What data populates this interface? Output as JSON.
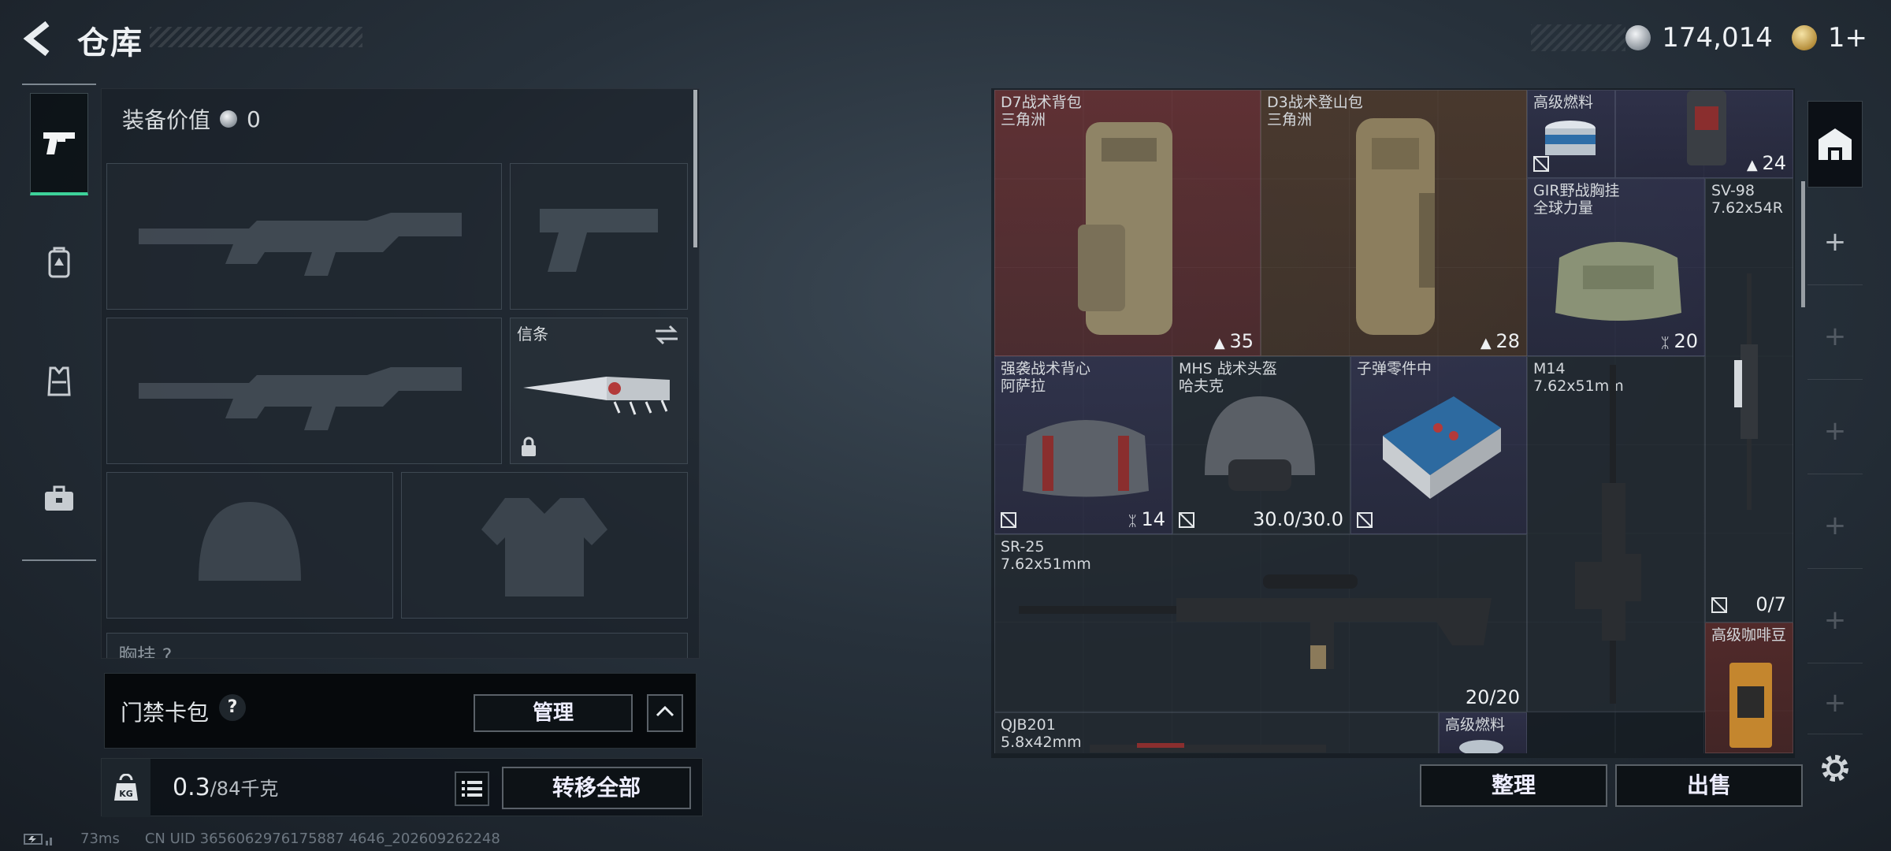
{
  "header": {
    "title": "仓库",
    "currency": {
      "silver": "174,014",
      "gold": "1+"
    }
  },
  "equipment": {
    "value_label": "装备价值",
    "value": "0",
    "slot_xintiao_label": "信条",
    "chest_row_label": "胸挂 ?"
  },
  "access_card": {
    "label": "门禁卡包",
    "help": "?",
    "manage": "管理"
  },
  "weight": {
    "current": "0.3",
    "max_unit": "/84千克",
    "transfer_all": "转移全部"
  },
  "footer": {
    "latency": "73ms",
    "uid": "CN UID 3656062976175887 4646_202609262248"
  },
  "stash": {
    "tidy": "整理",
    "sell": "出售",
    "items": [
      {
        "name": "D7战术背包",
        "sub": "三角洲",
        "count": "35",
        "color": "red"
      },
      {
        "name": "D3战术登山包",
        "sub": "三角洲",
        "count": "28",
        "color": "brown"
      },
      {
        "name": "高级燃料",
        "sub": "",
        "count": "",
        "color": "purple"
      },
      {
        "name": "",
        "sub": "",
        "count": "24",
        "color": "purple"
      },
      {
        "name": "GIR野战胸挂",
        "sub": "全球力量",
        "count": "20",
        "color": "purple"
      },
      {
        "name": "SV-98",
        "sub": "7.62x54R",
        "count": "0/7",
        "color": "gray"
      },
      {
        "name": "强袭战术背心",
        "sub": "阿萨拉",
        "count": "14",
        "color": "purple"
      },
      {
        "name": "MHS 战术头盔",
        "sub": "哈夫克",
        "count": "30.0/30.0",
        "color": "gray"
      },
      {
        "name": "子弹零件中",
        "sub": "",
        "count": "",
        "color": "purple"
      },
      {
        "name": "M14",
        "sub": "7.62x51mm",
        "count": "",
        "color": "gray"
      },
      {
        "name": "SR-25",
        "sub": "7.62x51mm",
        "count": "20/20",
        "color": "gray"
      },
      {
        "name": "高级咖啡豆",
        "sub": "",
        "count": "",
        "color": "darkred"
      },
      {
        "name": "QJB201",
        "sub": "5.8x42mm",
        "count": "",
        "color": "gray"
      },
      {
        "name": "高级燃料",
        "sub": "",
        "count": "",
        "color": "purple"
      }
    ]
  },
  "right_tabs": [
    "+",
    "+",
    "+",
    "+",
    "+",
    "+"
  ]
}
